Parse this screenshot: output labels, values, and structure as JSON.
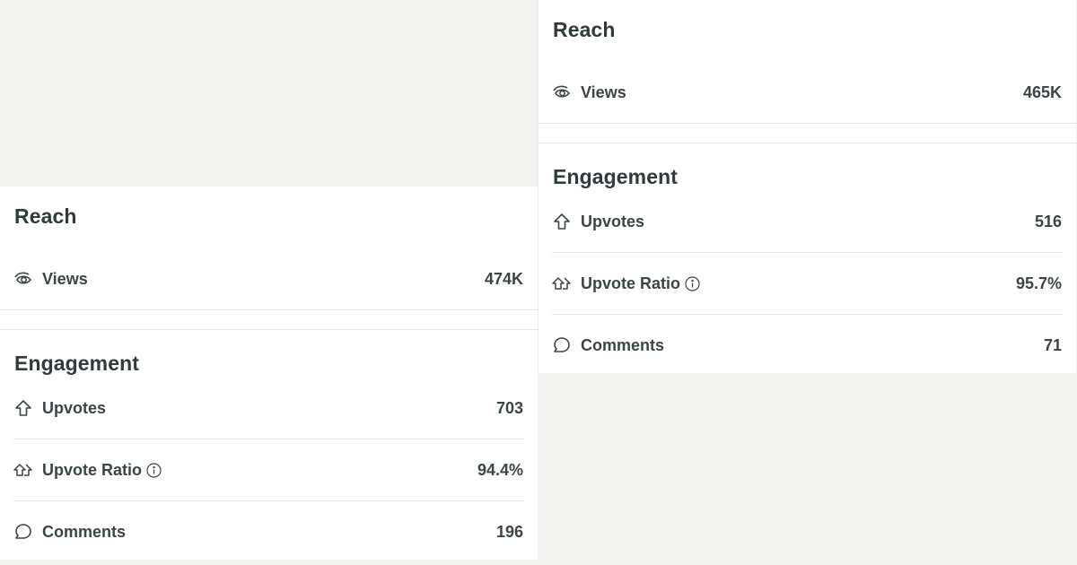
{
  "panels": [
    {
      "reach": {
        "title": "Reach",
        "views_label": "Views",
        "views_value": "474K"
      },
      "engagement": {
        "title": "Engagement",
        "upvotes_label": "Upvotes",
        "upvotes_value": "703",
        "ratio_label": "Upvote Ratio",
        "ratio_value": "94.4%",
        "comments_label": "Comments",
        "comments_value": "196"
      }
    },
    {
      "reach": {
        "title": "Reach",
        "views_label": "Views",
        "views_value": "465K"
      },
      "engagement": {
        "title": "Engagement",
        "upvotes_label": "Upvotes",
        "upvotes_value": "516",
        "ratio_label": "Upvote Ratio",
        "ratio_value": "95.7%",
        "comments_label": "Comments",
        "comments_value": "71"
      }
    }
  ],
  "icons": {
    "views": "eye-icon",
    "upvotes": "upvote-arrow-icon",
    "ratio": "upvote-ratio-icon",
    "info": "info-icon",
    "comments": "comment-bubble-icon"
  },
  "colors": {
    "background": "#f2f2ee",
    "panel": "#ffffff",
    "text": "#2f3b3d",
    "divider": "#e4e4e1"
  }
}
